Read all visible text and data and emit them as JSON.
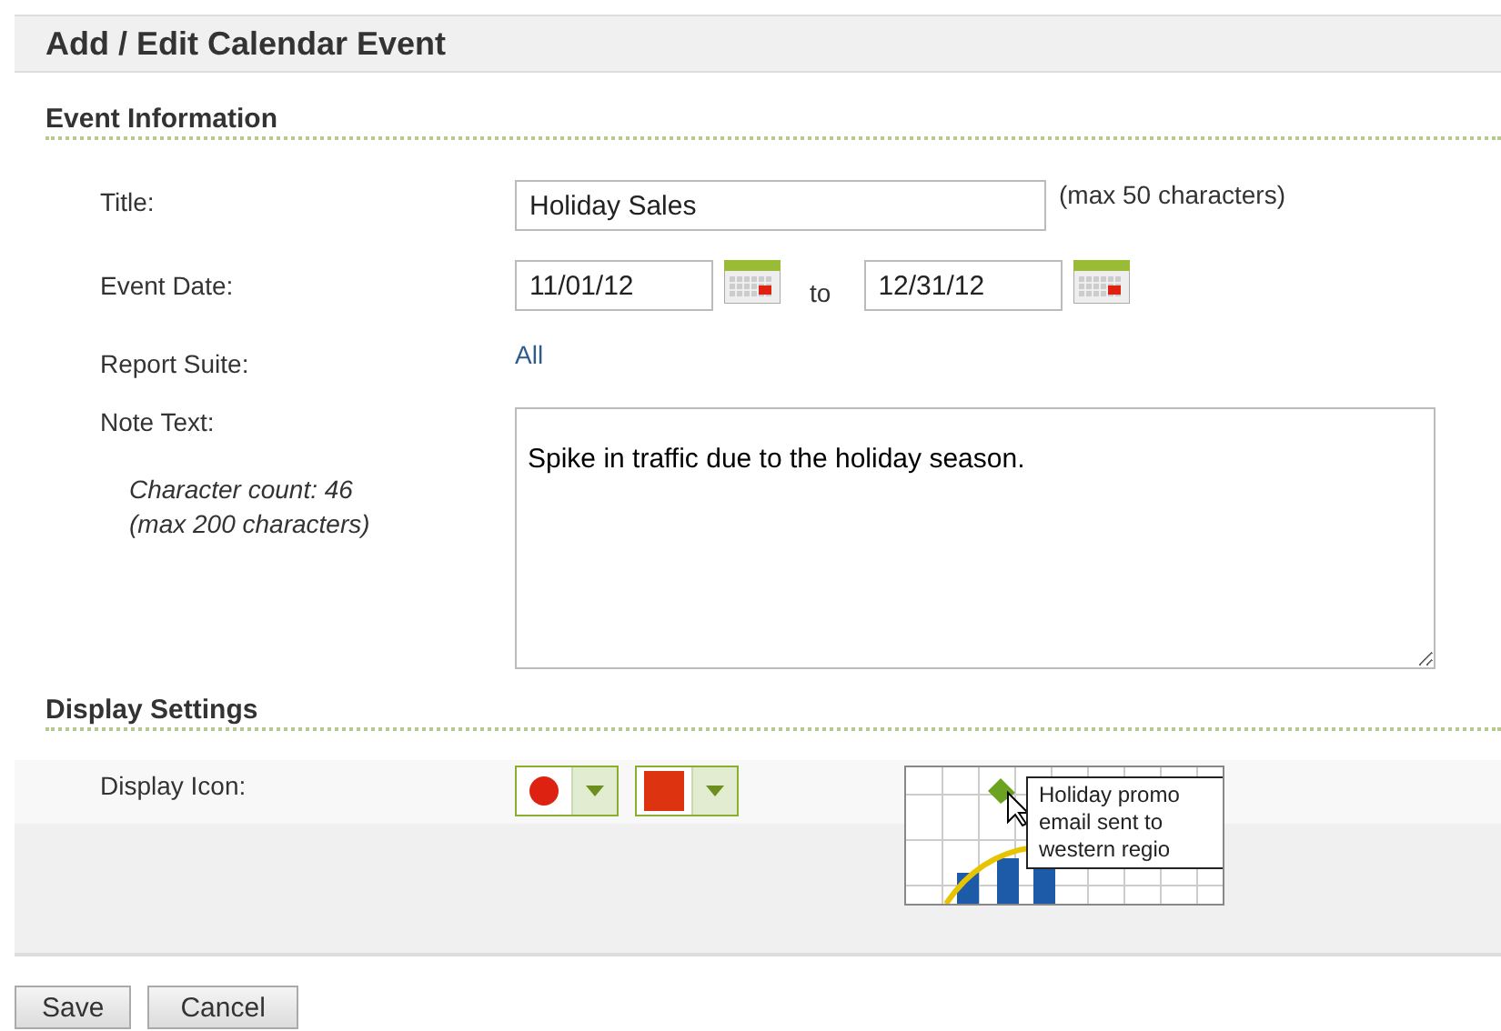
{
  "header": {
    "title": "Add / Edit Calendar Event"
  },
  "event_information": {
    "heading": "Event Information",
    "title": {
      "label": "Title:",
      "value": "Holiday Sales",
      "hint": "(max 50 characters)"
    },
    "event_date": {
      "label": "Event Date:",
      "start": "11/01/12",
      "separator": "to",
      "end": "12/31/12"
    },
    "report_suite": {
      "label": "Report Suite:",
      "value": "All"
    },
    "note_text": {
      "label": "Note Text:",
      "count": "Character count: 46",
      "max": "(max 200 characters)",
      "value": "Spike in traffic due to the holiday season."
    }
  },
  "display_settings": {
    "heading": "Display Settings",
    "label": "Display Icon:",
    "pickers": [
      {
        "kind": "circle",
        "color": "#dd2211"
      },
      {
        "kind": "square",
        "color": "#dd3311"
      }
    ],
    "preview": {
      "tooltip": [
        "Holiday promo",
        "email sent to",
        "western regio"
      ]
    }
  },
  "buttons": [
    "Save",
    "Cancel"
  ]
}
